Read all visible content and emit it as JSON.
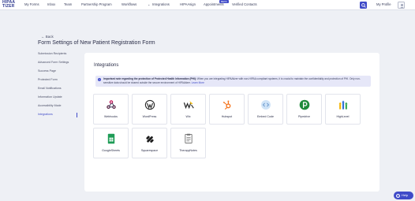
{
  "app": {
    "logo_line1": "HIPAA",
    "logo_line2": "TIZER"
  },
  "nav": {
    "items": [
      "My Forms",
      "Inbox",
      "Team",
      "Partnership Program",
      "Workflows",
      "Integrations",
      "HIPAAsign",
      "Appointments",
      "Verified Contacts"
    ],
    "integrations_chevron": "⌄",
    "badge": "BETA",
    "profile_label": "My Profile"
  },
  "header": {
    "back_label": "Back",
    "title": "Form Settings of New Patient Registration Form"
  },
  "sidebar": {
    "items": [
      {
        "label": "Submission Recipients",
        "active": false
      },
      {
        "label": "Advanced Form Settings",
        "active": false
      },
      {
        "label": "Success Page",
        "active": false
      },
      {
        "label": "Protected Form",
        "active": false
      },
      {
        "label": "Email Notifications",
        "active": false
      },
      {
        "label": "Information Update",
        "active": false
      },
      {
        "label": "Accessibility Mode",
        "active": false
      },
      {
        "label": "Integrations",
        "active": true
      }
    ]
  },
  "panel": {
    "title": "Integrations",
    "notice_bold": "Important note regarding the protection of Protected Health Information (PHI):",
    "notice_text": " When you are integrating HIPAAtizer with non-HIPAA compliant systems, it is crucial to maintain the confidentiality and protection of PHI. Only non-sensitive data should be shared outside the secure environment of HIPAAtizer.",
    "notice_link": "Learn More"
  },
  "integrations": [
    {
      "label": "Webhooks",
      "icon": "webhooks-icon"
    },
    {
      "label": "WordPress",
      "icon": "wordpress-icon"
    },
    {
      "label": "Wix",
      "icon": "wix-icon"
    },
    {
      "label": "Hubspot",
      "icon": "hubspot-icon"
    },
    {
      "label": "Embed Code",
      "icon": "embed-code-icon"
    },
    {
      "label": "Pipedrive",
      "icon": "pipedrive-icon"
    },
    {
      "label": "HighLevel",
      "icon": "highlevel-icon"
    },
    {
      "label": "GoogleSheets",
      "icon": "google-sheets-icon"
    },
    {
      "label": "Squarespace",
      "icon": "squarespace-icon"
    },
    {
      "label": "TherapyNotes",
      "icon": "therapynotes-icon"
    }
  ],
  "help": {
    "label": "Help",
    "glyph": "?"
  },
  "colors": {
    "accent": "#3f4ac8",
    "background": "#eef0f5",
    "notice_bg": "#e6e7f8"
  }
}
